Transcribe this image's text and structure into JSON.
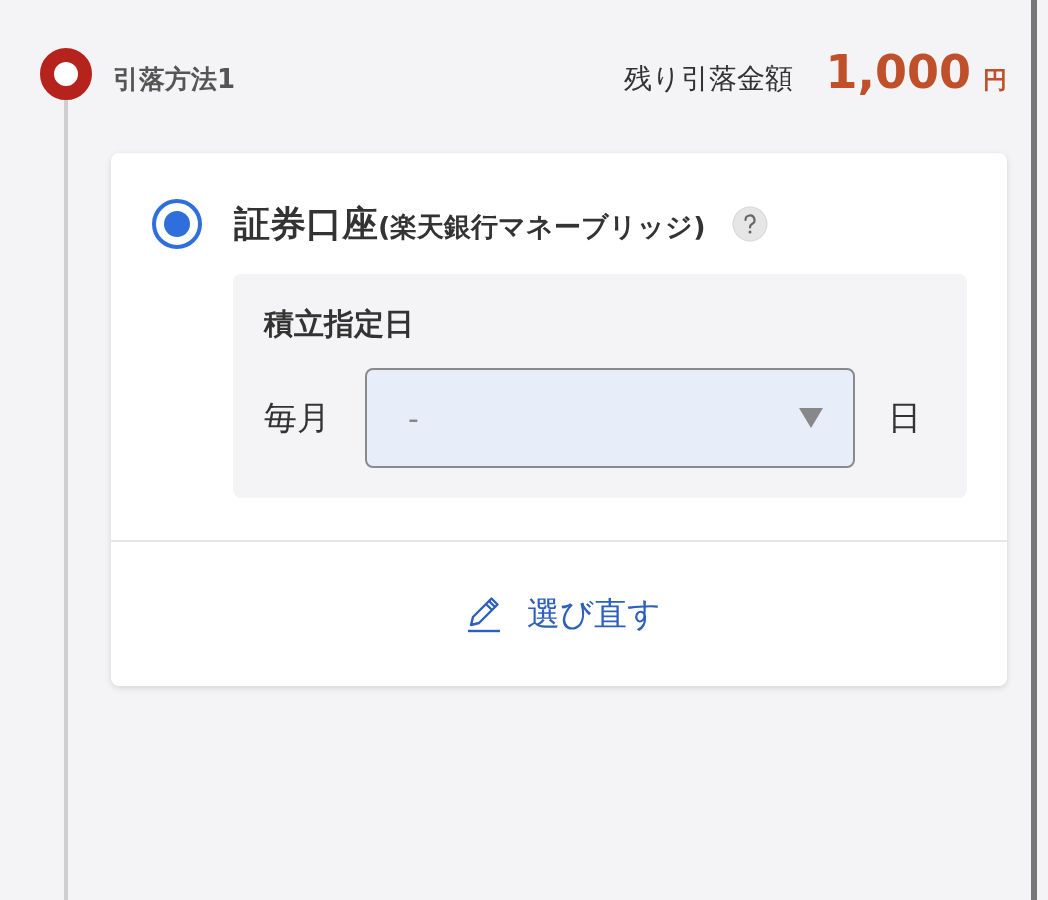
{
  "step": {
    "label": "引落方法1",
    "remaining_label": "残り引落金額",
    "remaining_amount": "1,000",
    "currency": "円"
  },
  "option": {
    "selected": true,
    "label": "証券口座",
    "label_note": "(楽天銀行マネーブリッジ)",
    "schedule": {
      "title": "積立指定日",
      "prefix": "毎月",
      "select_value": "-",
      "suffix": "日"
    }
  },
  "reselect_link": "選び直す"
}
